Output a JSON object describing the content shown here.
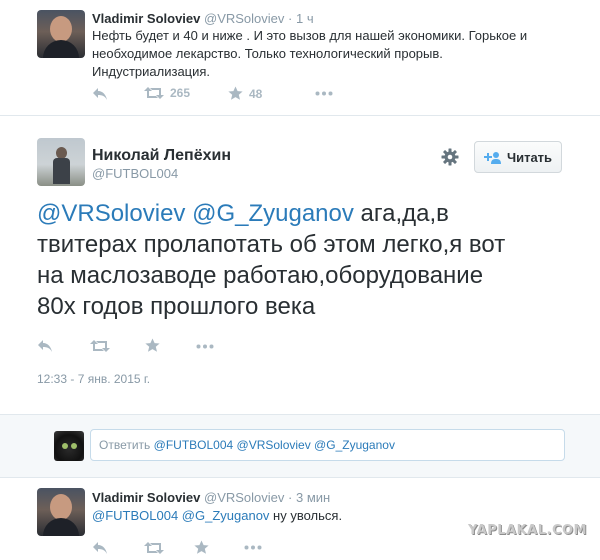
{
  "tweets": {
    "top": {
      "name": "Vladimir Soloviev",
      "handle": "@VRSoloviev",
      "time": "· 1 ч",
      "lines": [
        "Нефть будет и 40 и ниже . И это вызов для нашей экономики. Горькое и",
        "необходимое лекарство. Только технологический прорыв.",
        "Индустриализация."
      ],
      "retweets": "265",
      "favorites": "48"
    },
    "main": {
      "name": "Николай Лепёхин",
      "handle": "@FUTBOL004",
      "follow_label": "Читать",
      "mention1": "@VRSoloviev",
      "mention2": "@G_Zyuganov",
      "text_line1_rest": " ага,да,в",
      "text_line2": "твитерах пролапотать об этом легко,я вот",
      "text_line3": "на маслозаводе работаю,оборудование",
      "text_line4": "80х годов прошлого века",
      "timestamp": "12:33 - 7 янв. 2015 г."
    },
    "bottom": {
      "name": "Vladimir Soloviev",
      "handle": "@VRSoloviev",
      "time": "· 3 мин",
      "mention1": "@FUTBOL004",
      "mention2": "@G_Zyuganov",
      "text_rest": " ну уволься."
    }
  },
  "reply": {
    "prefix": "Ответить ",
    "mentions": "@FUTBOL004 @VRSoloviev @G_Zyuganov"
  },
  "watermark": "YAPLAKAL.COM",
  "icons": [
    "reply-icon",
    "retweet-icon",
    "favorite-icon",
    "more-icon",
    "gear-icon",
    "follow-user-icon"
  ],
  "colors": {
    "link": "#2b7bb9",
    "muted": "#8899a6",
    "text": "#292f33",
    "icon": "#aab8c2"
  }
}
